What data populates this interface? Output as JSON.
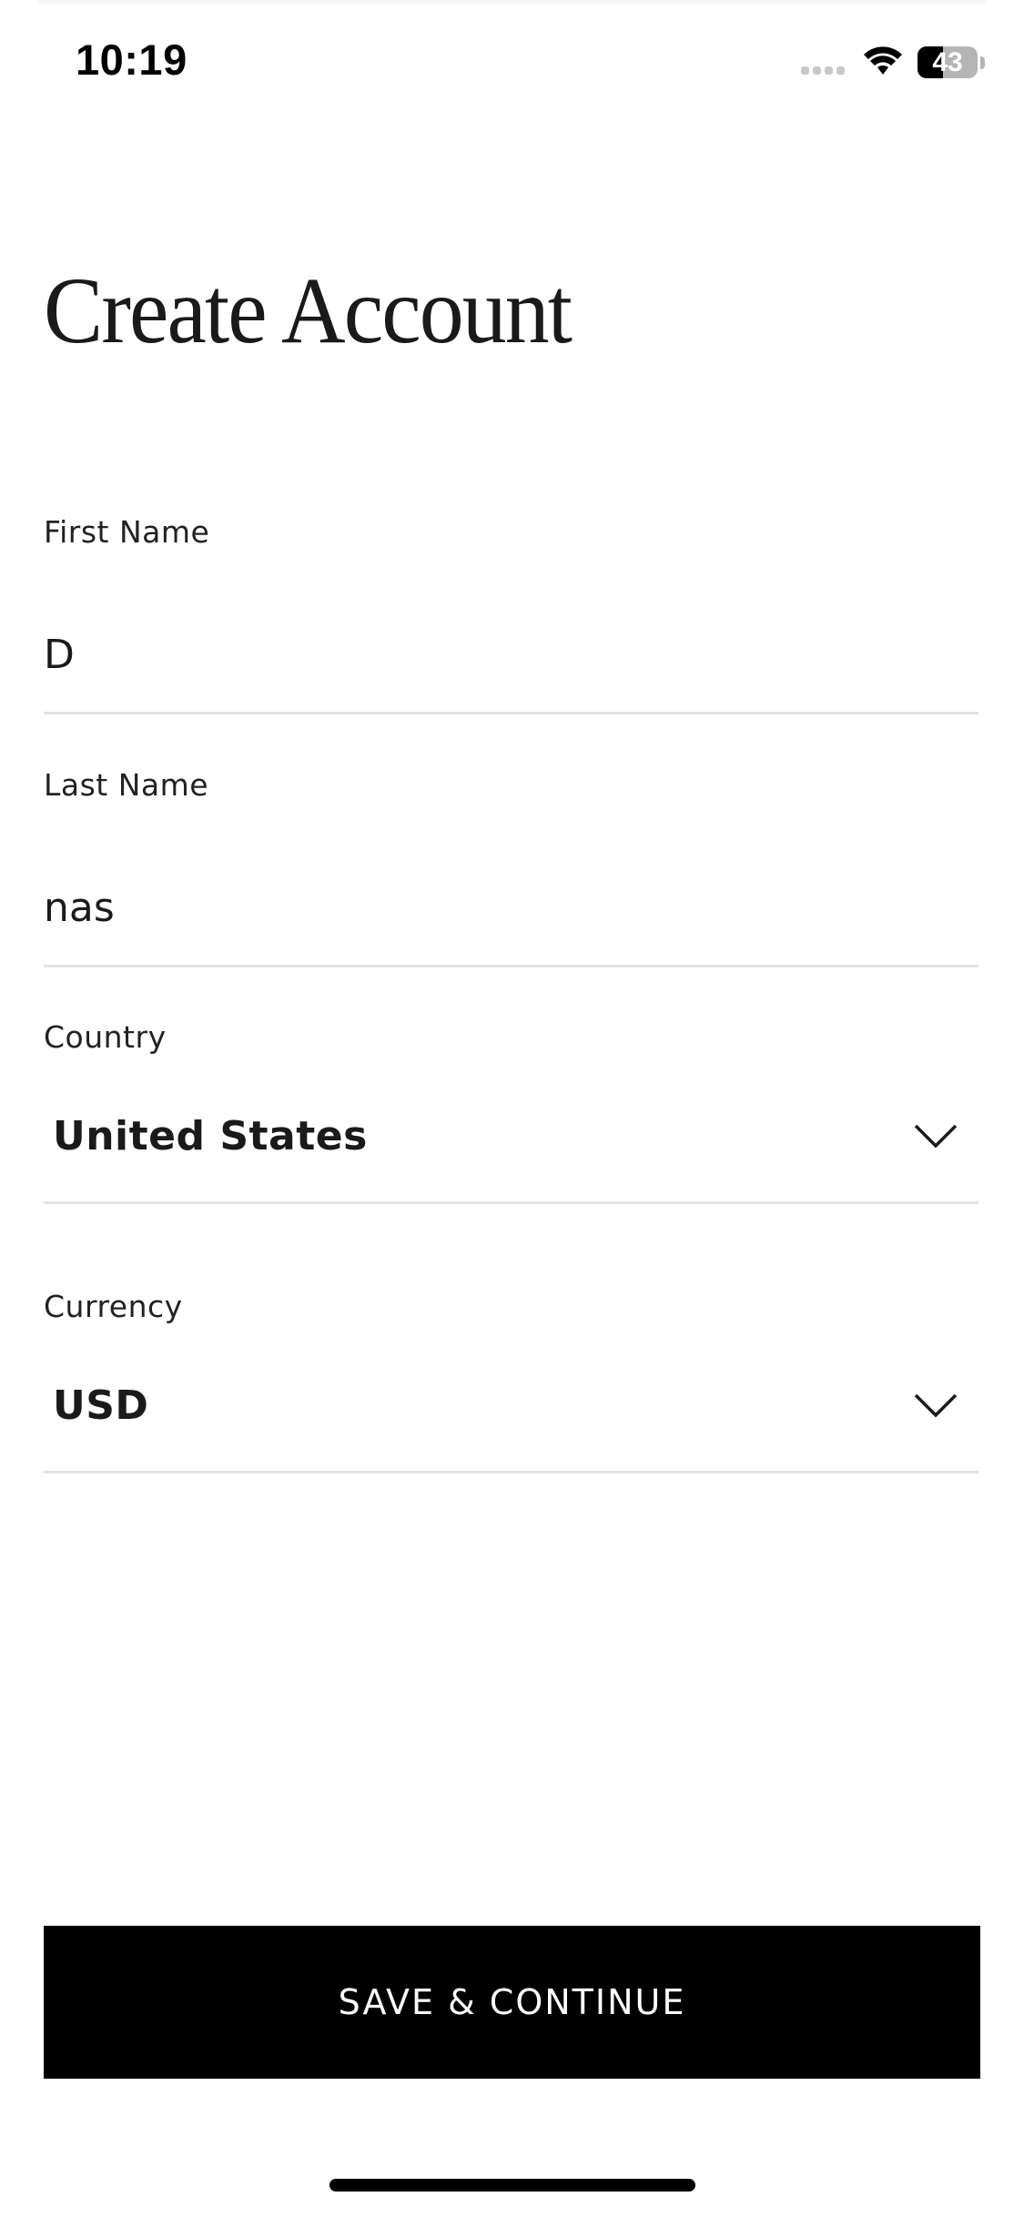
{
  "status_bar": {
    "time": "10:19",
    "battery_percent": "43",
    "battery_level": 0.43
  },
  "page": {
    "title": "Create Account"
  },
  "form": {
    "first_name": {
      "label": "First Name",
      "value": "D"
    },
    "last_name": {
      "label": "Last Name",
      "value": "nas"
    },
    "country": {
      "label": "Country",
      "value": "United States"
    },
    "currency": {
      "label": "Currency",
      "value": "USD"
    }
  },
  "actions": {
    "save_label": "SAVE & CONTINUE"
  },
  "icons": {
    "signal": "cellular-signal-icon",
    "wifi": "wifi-icon",
    "battery": "battery-icon",
    "chevron": "chevron-down-icon"
  },
  "colors": {
    "button_background": "#000000",
    "button_text": "#ffffff",
    "divider": "#e3e3e3",
    "text": "#1a1a1a"
  }
}
